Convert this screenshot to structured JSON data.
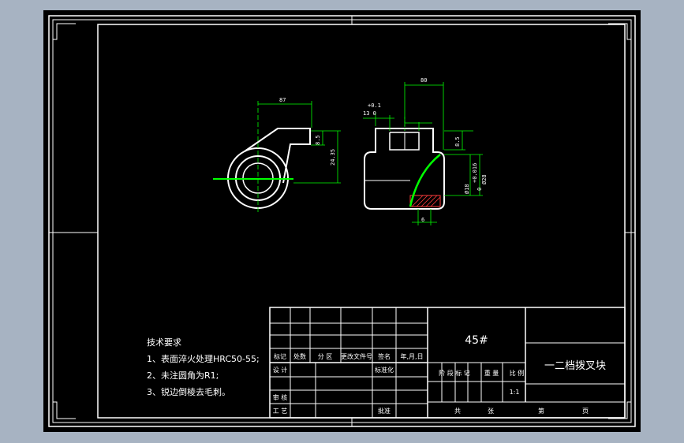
{
  "colors": {
    "background": "#a7b3c2",
    "paper": "#000000",
    "outline": "#ffffff",
    "dimension": "#00ff00",
    "hatch": "#ff3c3c"
  },
  "dimensions": {
    "d87": "87",
    "d80": "80",
    "d8_5_left": "8.5",
    "d24_35": "24.35",
    "tol_plus_01": "+0.1",
    "tol_13": "13 0",
    "d8_5_right": "8.5",
    "tol_upper": "+0.016",
    "tol_lower": "0",
    "dia_small": "Ø18",
    "dia_large": "Ø28",
    "d6": "6"
  },
  "notes": {
    "title": "技术要求",
    "items": [
      "1、表面淬火处理HRC50-55;",
      "2、未注圆角为R1;",
      "3、锐边倒棱去毛刺。"
    ]
  },
  "title_block": {
    "material": "45#",
    "part_name": "一二档拨叉块",
    "headers": [
      "标记",
      "处数",
      "分 区",
      "更改文件号",
      "签名",
      "年,月,日"
    ],
    "design": "设 计",
    "standardize": "标准化",
    "check": "审 核",
    "process": "工 艺",
    "approve": "批准",
    "stage_headers": [
      "阶 段 标 记",
      "重 量",
      "比 例"
    ],
    "scale": "1:1",
    "sheet_labels": [
      "共",
      "张",
      "第",
      "页"
    ]
  }
}
